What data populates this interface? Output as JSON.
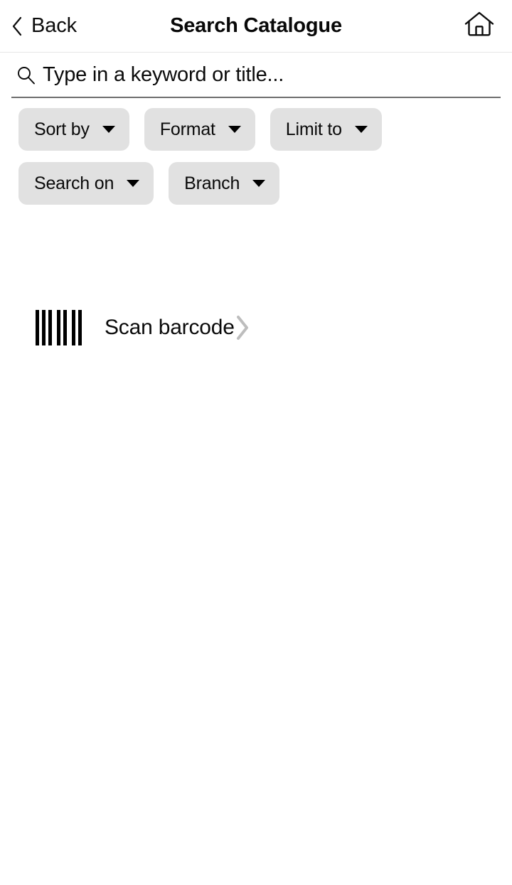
{
  "header": {
    "back_label": "Back",
    "title": "Search Catalogue",
    "back_icon": "chevron-left-icon",
    "home_icon": "home-icon"
  },
  "search": {
    "icon": "search-icon",
    "value": "",
    "placeholder": "Type in a keyword or title..."
  },
  "filters": {
    "rows": [
      [
        {
          "label": "Sort by",
          "icon": "chevron-down-icon"
        },
        {
          "label": "Format",
          "icon": "chevron-down-icon"
        },
        {
          "label": "Limit to",
          "icon": "chevron-down-icon"
        }
      ],
      [
        {
          "label": "Search on",
          "icon": "chevron-down-icon"
        },
        {
          "label": "Branch",
          "icon": "chevron-down-icon"
        }
      ]
    ]
  },
  "scan": {
    "icon": "barcode-icon",
    "label": "Scan barcode",
    "chevron_icon": "chevron-right-icon"
  },
  "colors": {
    "background": "#ffffff",
    "chip_background": "#e1e1e1",
    "text": "#0a0a0a",
    "divider": "#e6e6e6",
    "search_underline": "#6e6e6e",
    "chevron_gray": "#bdbdbd"
  }
}
